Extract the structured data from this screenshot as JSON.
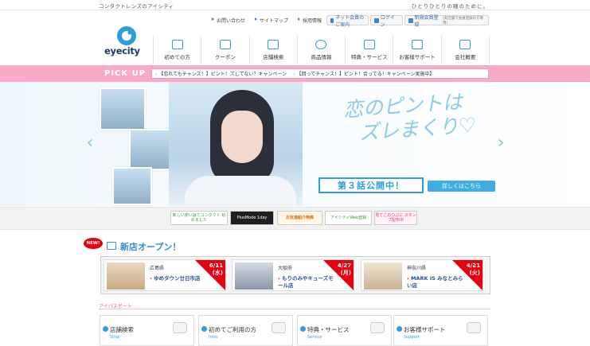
{
  "header": {
    "tagline_left": "コンタクトレンズのアイシティ",
    "tagline_right": "ひとりひとりの瞳のために。",
    "utility_links": [
      "お問い合わせ",
      "サイトマップ",
      "採用情報"
    ],
    "member_buttons": [
      "ネット会員のご案内",
      "ログイン",
      "新規会員登録"
    ],
    "member_button_note": "(実店舗で会員登録の方専用)",
    "logo_text": "eyecity"
  },
  "global_nav": [
    "初めての方",
    "クーポン",
    "店舗検索",
    "商品情報",
    "特典・サービス",
    "お客様サポート",
    "会社概要"
  ],
  "pickup": {
    "label": "PICK UP",
    "items": [
      "【恋れてもチャンス！】ピント！ズしてない？キャンペーン",
      "【回ってチャンス！】ピント！合ってる！キャンペーン実施中】"
    ]
  },
  "hero": {
    "script_text_1": "恋のピントは",
    "script_text_2": "ズレまくり♡",
    "episode": "第３話公開中！",
    "detail_button": "詳しくはこちら"
  },
  "banners": [
    "新しい使い捨てコンタクト 始めました",
    "PlusMode 1day",
    "お友達紹介特典",
    "アイシティWeb登録",
    "見てこのつぶに スタンプ配布中"
  ],
  "new_stores": {
    "badge": "NEW!",
    "title": "新店オープン！",
    "cards": [
      {
        "pref": "広島県",
        "name": "ゆめタウン廿日市店",
        "date": "6/11",
        "day": "(水)"
      },
      {
        "pref": "大阪府",
        "name": "もりのみやキューズモール店",
        "date": "4/27",
        "day": "(月)"
      },
      {
        "pref": "神奈川県",
        "name": "MARK IS みなとみらい店",
        "date": "4/21",
        "day": "(火)"
      }
    ]
  },
  "support": {
    "title": "アイパスポート",
    "cards": [
      {
        "label": "店舗検索",
        "sub": "Shop"
      },
      {
        "label": "初めてご利用の方",
        "sub": "Intro"
      },
      {
        "label": "特典・サービス",
        "sub": "Service"
      },
      {
        "label": "お客様サポート",
        "sub": "Support"
      }
    ]
  },
  "colors": {
    "accent_blue": "#2f9ed6",
    "pickup_pink": "#f9aac7",
    "new_red": "#e60012"
  }
}
